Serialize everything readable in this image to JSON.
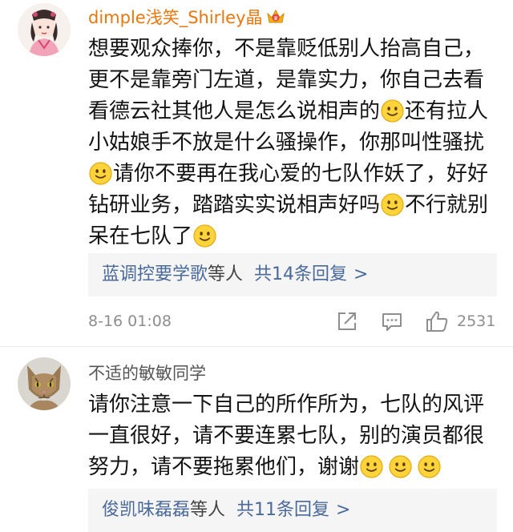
{
  "comments": [
    {
      "username": "dimple浅笑_Shirley晶",
      "lines": [
        "想要观众捧你，不是靠贬低别人抬高自己，",
        "更不是靠旁门左道，是靠实力，你自己去看",
        "看德云社其他人是怎么说相声的",
        "还有拉人",
        "小姑娘手不放是什么骚操作，你那叫性骚扰",
        "请你不要再在我心爱的七队作妖了，好好",
        "钻研业务，踏踏实实说相声好吗",
        "不行就别",
        "呆在七队了"
      ],
      "reply_names": "蓝调控要学歌",
      "reply_mid": "等人",
      "reply_count": "共14条回复",
      "reply_chevron": ">",
      "timestamp": "8-16 01:08",
      "like_count": "2531",
      "name_color": "#e9770d",
      "badge_icon": "crown-icon"
    },
    {
      "username": "不适的敏敏同学",
      "lines": [
        "请你注意一下自己的所作所为，七队的风评",
        "一直很好，请不要连累七队，别的演员都很",
        "努力，请不要拖累他们，谢谢"
      ],
      "reply_names": "俊凯味磊磊",
      "reply_mid": "等人",
      "reply_count": "共11条回复",
      "reply_chevron": ">"
    }
  ],
  "colors": {
    "link": "#4a6a9b",
    "meta": "#8e8e8e",
    "reply_bg": "#f5f5f5"
  }
}
